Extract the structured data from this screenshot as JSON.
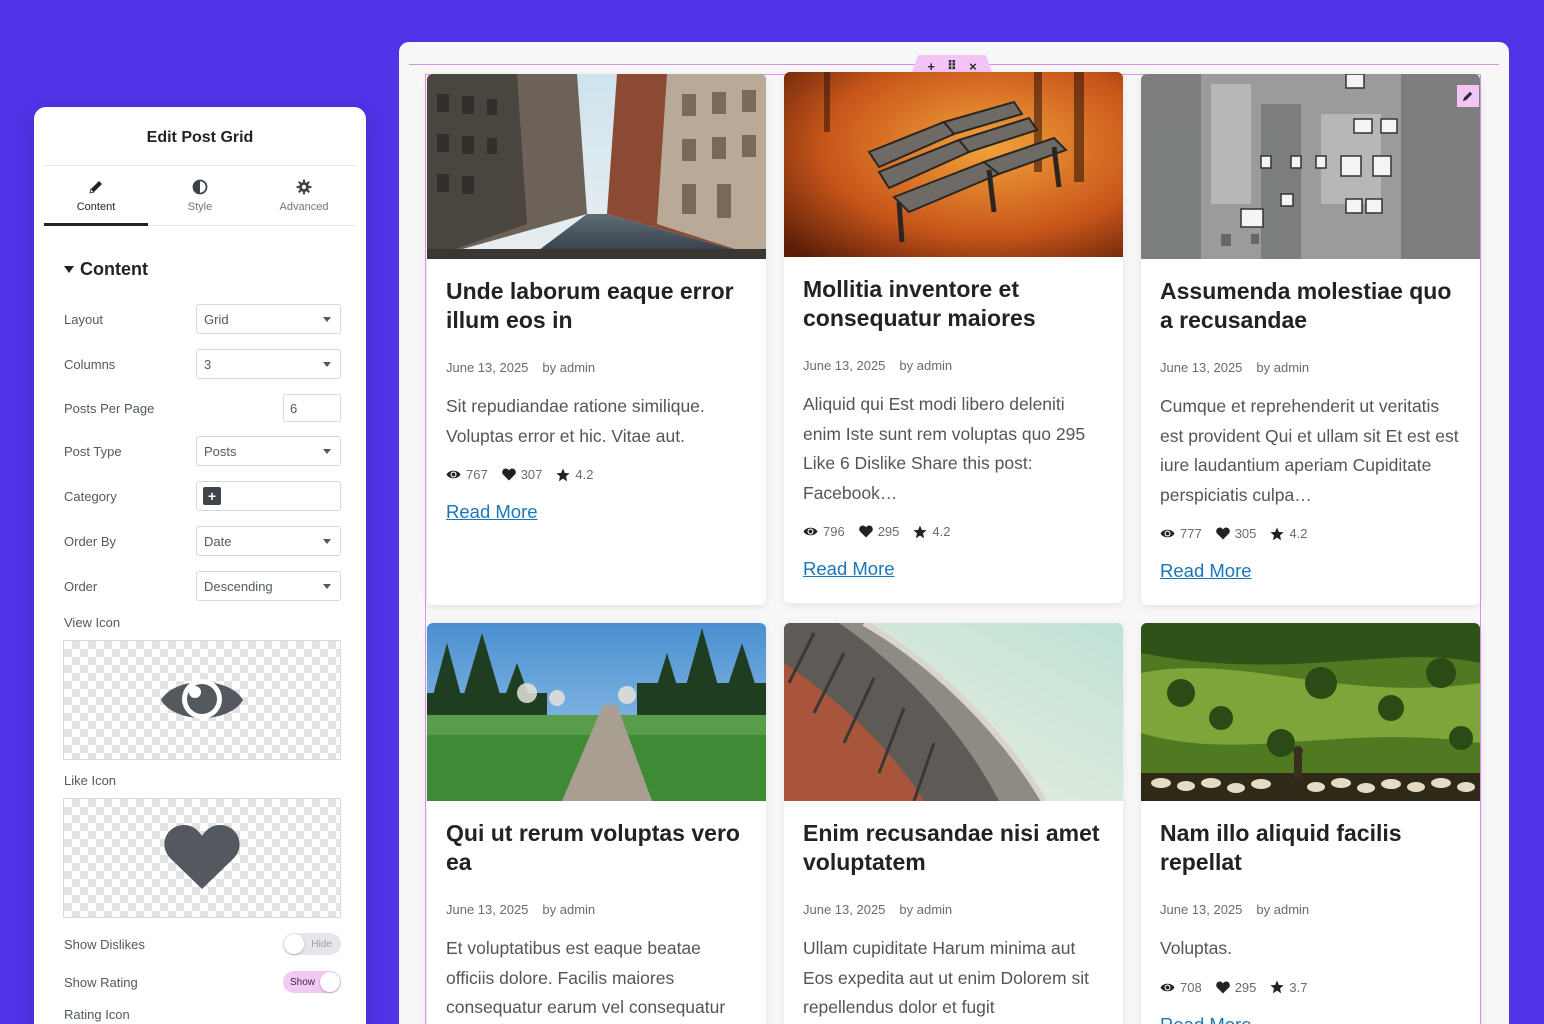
{
  "panel": {
    "title": "Edit Post Grid",
    "tabs": [
      {
        "label": "Content",
        "icon": "pencil-icon",
        "active": true
      },
      {
        "label": "Style",
        "icon": "contrast-icon",
        "active": false
      },
      {
        "label": "Advanced",
        "icon": "gear-icon",
        "active": false
      }
    ],
    "section": "Content",
    "layout": {
      "label": "Layout",
      "value": "Grid"
    },
    "columns": {
      "label": "Columns",
      "value": "3"
    },
    "posts_per_page": {
      "label": "Posts Per Page",
      "value": "6"
    },
    "post_type": {
      "label": "Post Type",
      "value": "Posts"
    },
    "category": {
      "label": "Category"
    },
    "order_by": {
      "label": "Order By",
      "value": "Date"
    },
    "order": {
      "label": "Order",
      "value": "Descending"
    },
    "view_icon": {
      "label": "View Icon"
    },
    "like_icon": {
      "label": "Like Icon"
    },
    "show_dislikes": {
      "label": "Show Dislikes",
      "toggle": "Hide"
    },
    "show_rating": {
      "label": "Show Rating",
      "toggle": "Show"
    },
    "rating_icon": {
      "label": "Rating Icon"
    }
  },
  "canvas": {
    "handle": {
      "add": "+",
      "move": "⠿",
      "close": "×"
    }
  },
  "posts": [
    {
      "title": "Unde laborum eaque error illum eos in",
      "date": "June 13, 2025",
      "author": "by admin",
      "excerpt": "Sit repudiandae ratione similique. Voluptas error et hic. Vitae aut.",
      "views": "767",
      "likes": "307",
      "rating": "4.2",
      "read_more": "Read More"
    },
    {
      "title": "Mollitia inventore et consequatur maiores",
      "date": "June 13, 2025",
      "author": "by admin",
      "excerpt": "Aliquid qui Est modi libero deleniti enim Iste sunt rem voluptas quo 295 Like 6 Dislike Share this post: Facebook…",
      "views": "796",
      "likes": "295",
      "rating": "4.2",
      "read_more": "Read More"
    },
    {
      "title": "Assumenda molestiae quo a recusandae",
      "date": "June 13, 2025",
      "author": "by admin",
      "excerpt": "Cumque et reprehenderit ut veritatis est provident Qui et ullam sit Et est est iure laudantium aperiam Cupiditate perspiciatis culpa…",
      "views": "777",
      "likes": "305",
      "rating": "4.2",
      "read_more": "Read More"
    },
    {
      "title": "Qui ut rerum voluptas vero ea",
      "date": "June 13, 2025",
      "author": "by admin",
      "excerpt": "Et voluptatibus est eaque beatae officiis dolore. Facilis maiores consequatur earum vel consequatur",
      "views": "",
      "likes": "",
      "rating": "",
      "read_more": ""
    },
    {
      "title": "Enim recusandae nisi amet voluptatem",
      "date": "June 13, 2025",
      "author": "by admin",
      "excerpt": "Ullam cupiditate Harum minima aut Eos expedita aut ut enim Dolorem sit repellendus dolor et fugit",
      "views": "",
      "likes": "",
      "rating": "",
      "read_more": ""
    },
    {
      "title": "Nam illo aliquid facilis repellat",
      "date": "June 13, 2025",
      "author": "by admin",
      "excerpt": "Voluptas.",
      "views": "708",
      "likes": "295",
      "rating": "3.7",
      "read_more": "Read More"
    }
  ],
  "colors": {
    "background": "#5233e8",
    "link": "#1976b8",
    "selection": "#e58ff0",
    "toggle_on": "#f2c8f4"
  }
}
